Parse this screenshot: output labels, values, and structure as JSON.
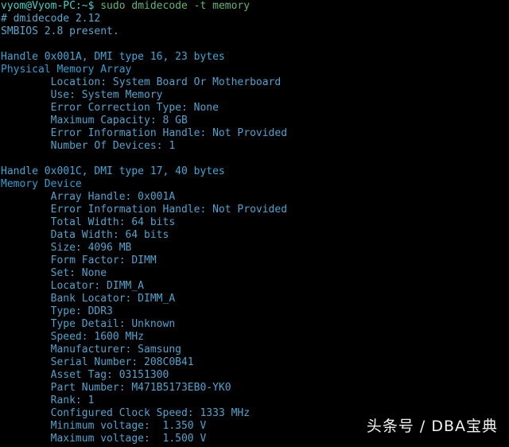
{
  "terminal": {
    "background_color": "#000000",
    "prompt_color": "#45d0c8",
    "command_color": "#63b47a",
    "output_color": "#4fa3cf",
    "prompt": "vyom@Vyom-PC:~$",
    "command": "sudo dmidecode -t memory",
    "lines": [
      {
        "kind": "prompt",
        "prompt": "vyom@Vyom-PC:~$",
        "command": " sudo dmidecode -t memory"
      },
      {
        "kind": "plain",
        "text": "# dmidecode 2.12"
      },
      {
        "kind": "plain",
        "text": "SMBIOS 2.8 present."
      },
      {
        "kind": "blank",
        "text": ""
      },
      {
        "kind": "header",
        "text": "Handle 0x001A, DMI type 16, 23 bytes"
      },
      {
        "kind": "title",
        "text": "Physical Memory Array"
      },
      {
        "kind": "detail",
        "text": "        Location: System Board Or Motherboard"
      },
      {
        "kind": "detail",
        "text": "        Use: System Memory"
      },
      {
        "kind": "detail",
        "text": "        Error Correction Type: None"
      },
      {
        "kind": "detail",
        "text": "        Maximum Capacity: 8 GB"
      },
      {
        "kind": "detail",
        "text": "        Error Information Handle: Not Provided"
      },
      {
        "kind": "detail",
        "text": "        Number Of Devices: 1"
      },
      {
        "kind": "blank",
        "text": ""
      },
      {
        "kind": "header",
        "text": "Handle 0x001C, DMI type 17, 40 bytes"
      },
      {
        "kind": "title",
        "text": "Memory Device"
      },
      {
        "kind": "detail",
        "text": "        Array Handle: 0x001A"
      },
      {
        "kind": "detail",
        "text": "        Error Information Handle: Not Provided"
      },
      {
        "kind": "detail",
        "text": "        Total Width: 64 bits"
      },
      {
        "kind": "detail",
        "text": "        Data Width: 64 bits"
      },
      {
        "kind": "detail",
        "text": "        Size: 4096 MB"
      },
      {
        "kind": "detail",
        "text": "        Form Factor: DIMM"
      },
      {
        "kind": "detail",
        "text": "        Set: None"
      },
      {
        "kind": "detail",
        "text": "        Locator: DIMM_A"
      },
      {
        "kind": "detail",
        "text": "        Bank Locator: DIMM_A"
      },
      {
        "kind": "detail",
        "text": "        Type: DDR3"
      },
      {
        "kind": "detail",
        "text": "        Type Detail: Unknown"
      },
      {
        "kind": "detail",
        "text": "        Speed: 1600 MHz"
      },
      {
        "kind": "detail",
        "text": "        Manufacturer: Samsung"
      },
      {
        "kind": "detail",
        "text": "        Serial Number: 208C0B41"
      },
      {
        "kind": "detail",
        "text": "        Asset Tag: 03151300"
      },
      {
        "kind": "detail",
        "text": "        Part Number: M471B5173EB0-YK0"
      },
      {
        "kind": "detail",
        "text": "        Rank: 1"
      },
      {
        "kind": "detail",
        "text": "        Configured Clock Speed: 1333 MHz"
      },
      {
        "kind": "detail",
        "text": "        Minimum voltage:  1.350 V"
      },
      {
        "kind": "detail",
        "text": "        Maximum voltage:  1.500 V"
      }
    ],
    "parsed": {
      "dmidecode_version": "2.12",
      "smbios_version": "2.8",
      "physical_memory_array": {
        "handle": "0x001A",
        "dmi_type": "16",
        "bytes": "23",
        "location": "System Board Or Motherboard",
        "use": "System Memory",
        "error_correction_type": "None",
        "maximum_capacity": "8 GB",
        "error_information_handle": "Not Provided",
        "number_of_devices": "1"
      },
      "memory_device": {
        "handle": "0x001C",
        "dmi_type": "17",
        "bytes": "40",
        "array_handle": "0x001A",
        "error_information_handle": "Not Provided",
        "total_width": "64 bits",
        "data_width": "64 bits",
        "size": "4096 MB",
        "form_factor": "DIMM",
        "set": "None",
        "locator": "DIMM_A",
        "bank_locator": "DIMM_A",
        "type": "DDR3",
        "type_detail": "Unknown",
        "speed": "1600 MHz",
        "manufacturer": "Samsung",
        "serial_number": "208C0B41",
        "asset_tag": "03151300",
        "part_number": "M471B5173EB0-YK0",
        "rank": "1",
        "configured_clock_speed": "1333 MHz",
        "minimum_voltage": "1.350 V",
        "maximum_voltage": "1.500 V"
      }
    }
  },
  "watermark": {
    "text": "头条号 / DBA宝典",
    "color": "#f2f2f2"
  }
}
